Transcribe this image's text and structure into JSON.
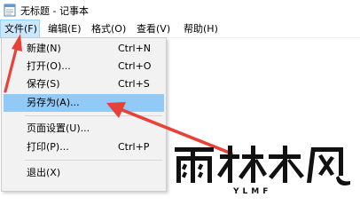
{
  "window": {
    "title": "无标题 - 记事本",
    "app_icon": "notepad-icon"
  },
  "menubar": {
    "items": [
      "文件(F)",
      "编辑(E)",
      "格式(O)",
      "查看(V)",
      "帮助(H)"
    ],
    "active": "文件(F)"
  },
  "file_menu": {
    "items": [
      {
        "label": "新建(N)",
        "shortcut": "Ctrl+N"
      },
      {
        "label": "打开(O)...",
        "shortcut": "Ctrl+O"
      },
      {
        "label": "保存(S)",
        "shortcut": "Ctrl+S"
      },
      {
        "label": "另存为(A)...",
        "shortcut": "",
        "highlighted": true
      },
      {
        "label": "页面设置(U)...",
        "shortcut": ""
      },
      {
        "label": "打印(P)...",
        "shortcut": "Ctrl+P"
      },
      {
        "label": "退出(X)",
        "shortcut": ""
      }
    ]
  },
  "annotations": {
    "arrow_color": "#e8413a"
  },
  "watermark": {
    "logo_text": "雨林木风",
    "sub_text": "YLMF"
  },
  "colors": {
    "menu_active_bg": "#cce8ff",
    "item_highlight_bg": "#91c9f7",
    "dropdown_bg": "#f2f2f2"
  }
}
